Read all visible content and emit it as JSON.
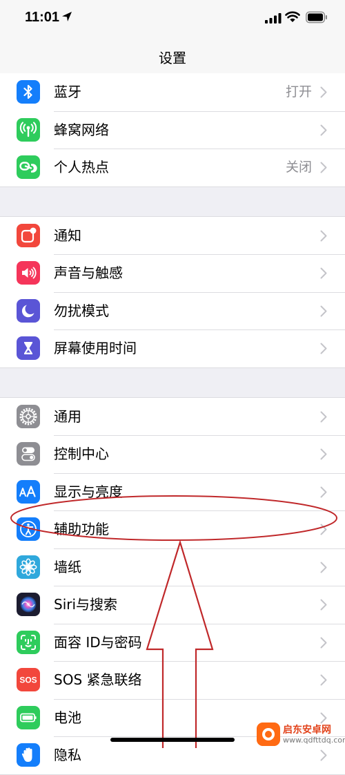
{
  "status_bar": {
    "time": "11:01"
  },
  "nav": {
    "title": "设置"
  },
  "groups": [
    {
      "rows": [
        {
          "label": "蓝牙",
          "value": "打开",
          "icon": "bluetooth-icon",
          "color": "#147efb"
        },
        {
          "label": "蜂窝网络",
          "value": "",
          "icon": "cellular-icon",
          "color": "#2ecc5c"
        },
        {
          "label": "个人热点",
          "value": "关闭",
          "icon": "hotspot-icon",
          "color": "#2ecc5c"
        }
      ]
    },
    {
      "rows": [
        {
          "label": "通知",
          "value": "",
          "icon": "notifications-icon",
          "color": "#f2473c"
        },
        {
          "label": "声音与触感",
          "value": "",
          "icon": "sound-icon",
          "color": "#f5355a"
        },
        {
          "label": "勿扰模式",
          "value": "",
          "icon": "moon-icon",
          "color": "#5a55d6"
        },
        {
          "label": "屏幕使用时间",
          "value": "",
          "icon": "hourglass-icon",
          "color": "#5a55d6"
        }
      ]
    },
    {
      "rows": [
        {
          "label": "通用",
          "value": "",
          "icon": "gear-icon",
          "color": "#8e8e93"
        },
        {
          "label": "控制中心",
          "value": "",
          "icon": "toggles-icon",
          "color": "#8e8e93"
        },
        {
          "label": "显示与亮度",
          "value": "",
          "icon": "text-size-icon",
          "color": "#147efb"
        },
        {
          "label": "辅助功能",
          "value": "",
          "icon": "accessibility-icon",
          "color": "#147efb"
        },
        {
          "label": "墙纸",
          "value": "",
          "icon": "flower-icon",
          "color": "#2fa8dc"
        },
        {
          "label": "Siri与搜索",
          "value": "",
          "icon": "siri-icon",
          "color": "#1c1c30"
        },
        {
          "label": "面容 ID与密码",
          "value": "",
          "icon": "face-id-icon",
          "color": "#2ecc5c"
        },
        {
          "label": "SOS 紧急联络",
          "value": "",
          "icon": "sos-icon",
          "color": "#f2473c",
          "icon_text": "SOS"
        },
        {
          "label": "电池",
          "value": "",
          "icon": "battery-setting-icon",
          "color": "#2ecc5c"
        },
        {
          "label": "隐私",
          "value": "",
          "icon": "hand-icon",
          "color": "#147efb"
        }
      ]
    }
  ],
  "watermark": {
    "title": "启东安卓网",
    "url": "www.qdfttdq.com"
  }
}
